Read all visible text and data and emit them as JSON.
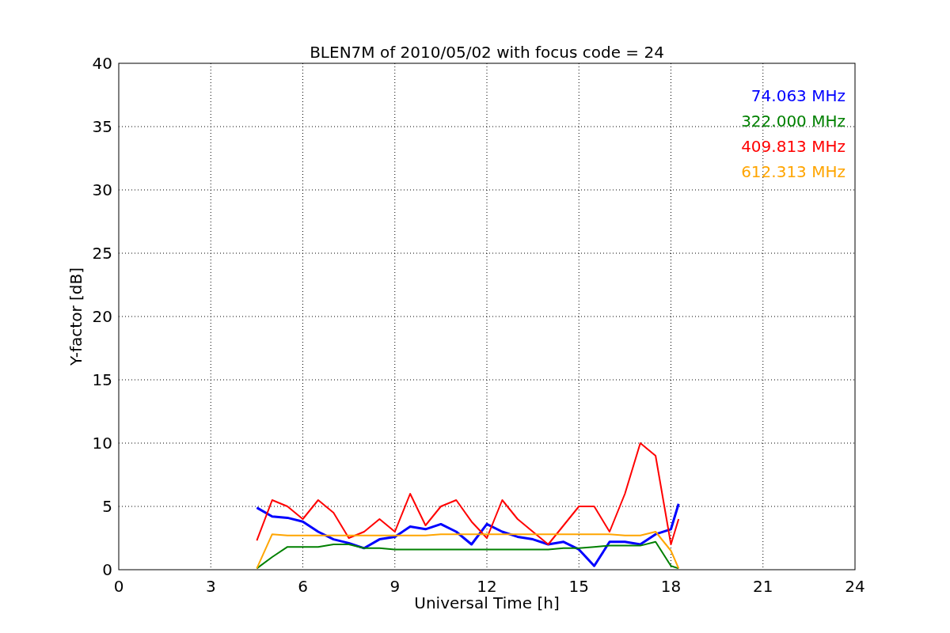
{
  "chart_data": {
    "type": "line",
    "title": "BLEN7M of 2010/05/02 with focus code = 24",
    "xlabel": "Universal Time [h]",
    "ylabel": "Y-factor [dB]",
    "x": [
      4.5,
      5.0,
      5.5,
      6.0,
      6.5,
      7.0,
      7.5,
      8.0,
      8.5,
      9.0,
      9.5,
      10.0,
      10.5,
      11.0,
      11.5,
      12.0,
      12.5,
      13.0,
      13.5,
      14.0,
      14.5,
      15.0,
      15.5,
      16.0,
      16.5,
      17.0,
      17.5,
      18.0,
      18.25
    ],
    "series": [
      {
        "name": "74.063 MHz",
        "color": "#0000ff",
        "values": [
          4.9,
          4.2,
          4.1,
          3.8,
          3.0,
          2.4,
          2.1,
          1.7,
          2.4,
          2.6,
          3.4,
          3.2,
          3.6,
          3.0,
          2.0,
          3.6,
          3.0,
          2.6,
          2.4,
          2.0,
          2.2,
          1.6,
          0.3,
          2.2,
          2.2,
          2.0,
          2.8,
          3.2,
          5.2
        ]
      },
      {
        "name": "322.000 MHz",
        "color": "#008000",
        "values": [
          0.1,
          1.0,
          1.8,
          1.8,
          1.8,
          2.0,
          2.0,
          1.7,
          1.7,
          1.6,
          1.6,
          1.6,
          1.6,
          1.6,
          1.6,
          1.6,
          1.6,
          1.6,
          1.6,
          1.6,
          1.7,
          1.7,
          1.8,
          1.9,
          1.9,
          1.9,
          2.2,
          0.3,
          0.1
        ]
      },
      {
        "name": "409.813 MHz",
        "color": "#ff0000",
        "values": [
          2.3,
          5.5,
          5.0,
          4.0,
          5.5,
          4.5,
          2.5,
          3.0,
          4.0,
          3.0,
          6.0,
          3.5,
          5.0,
          5.5,
          3.8,
          2.5,
          5.5,
          4.0,
          3.0,
          2.0,
          3.5,
          5.0,
          5.0,
          3.0,
          6.0,
          10.0,
          9.0,
          2.0,
          4.0
        ]
      },
      {
        "name": "612.313 MHz",
        "color": "#ffa500",
        "values": [
          0.1,
          2.8,
          2.7,
          2.7,
          2.7,
          2.7,
          2.7,
          2.7,
          2.7,
          2.7,
          2.7,
          2.7,
          2.8,
          2.8,
          2.8,
          2.8,
          2.8,
          2.8,
          2.8,
          2.8,
          2.8,
          2.8,
          2.8,
          2.8,
          2.7,
          2.7,
          3.0,
          1.5,
          0.1
        ]
      }
    ],
    "grid": true,
    "xlim": [
      0,
      24
    ],
    "ylim": [
      0,
      40
    ],
    "xticks": [
      0,
      3,
      6,
      9,
      12,
      15,
      18,
      21,
      24
    ],
    "yticks": [
      0,
      5,
      10,
      15,
      20,
      25,
      30,
      35,
      40
    ]
  }
}
